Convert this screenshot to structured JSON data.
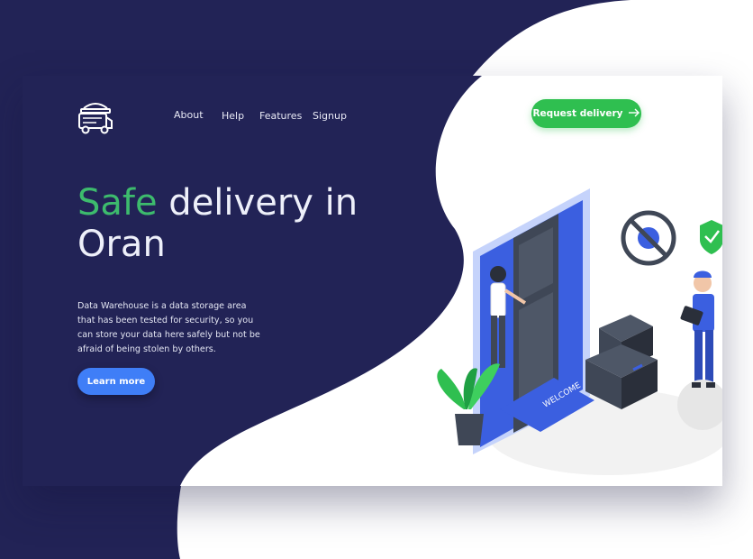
{
  "brand": {
    "logo_icon": "delivery-van-icon"
  },
  "nav": {
    "items": [
      "About",
      "Help",
      "Features",
      "Signup"
    ]
  },
  "cta": {
    "request_label": "Request delivery",
    "request_icon": "arrow-right-icon"
  },
  "hero": {
    "title_accent": "Safe",
    "title_rest_line1": " delivery in",
    "title_line2": "Oran",
    "description": "Data Warehouse is a data storage area that has been  tested for security, so you can store your data here  safely but not be afraid of being stolen by others.",
    "learn_more_label": "Learn more"
  },
  "illustration": {
    "mat_text": "WELCOME"
  },
  "colors": {
    "navy": "#222356",
    "green": "#3dbb6d",
    "button_green": "#2fbf50",
    "button_blue": "#3f7ef7"
  }
}
